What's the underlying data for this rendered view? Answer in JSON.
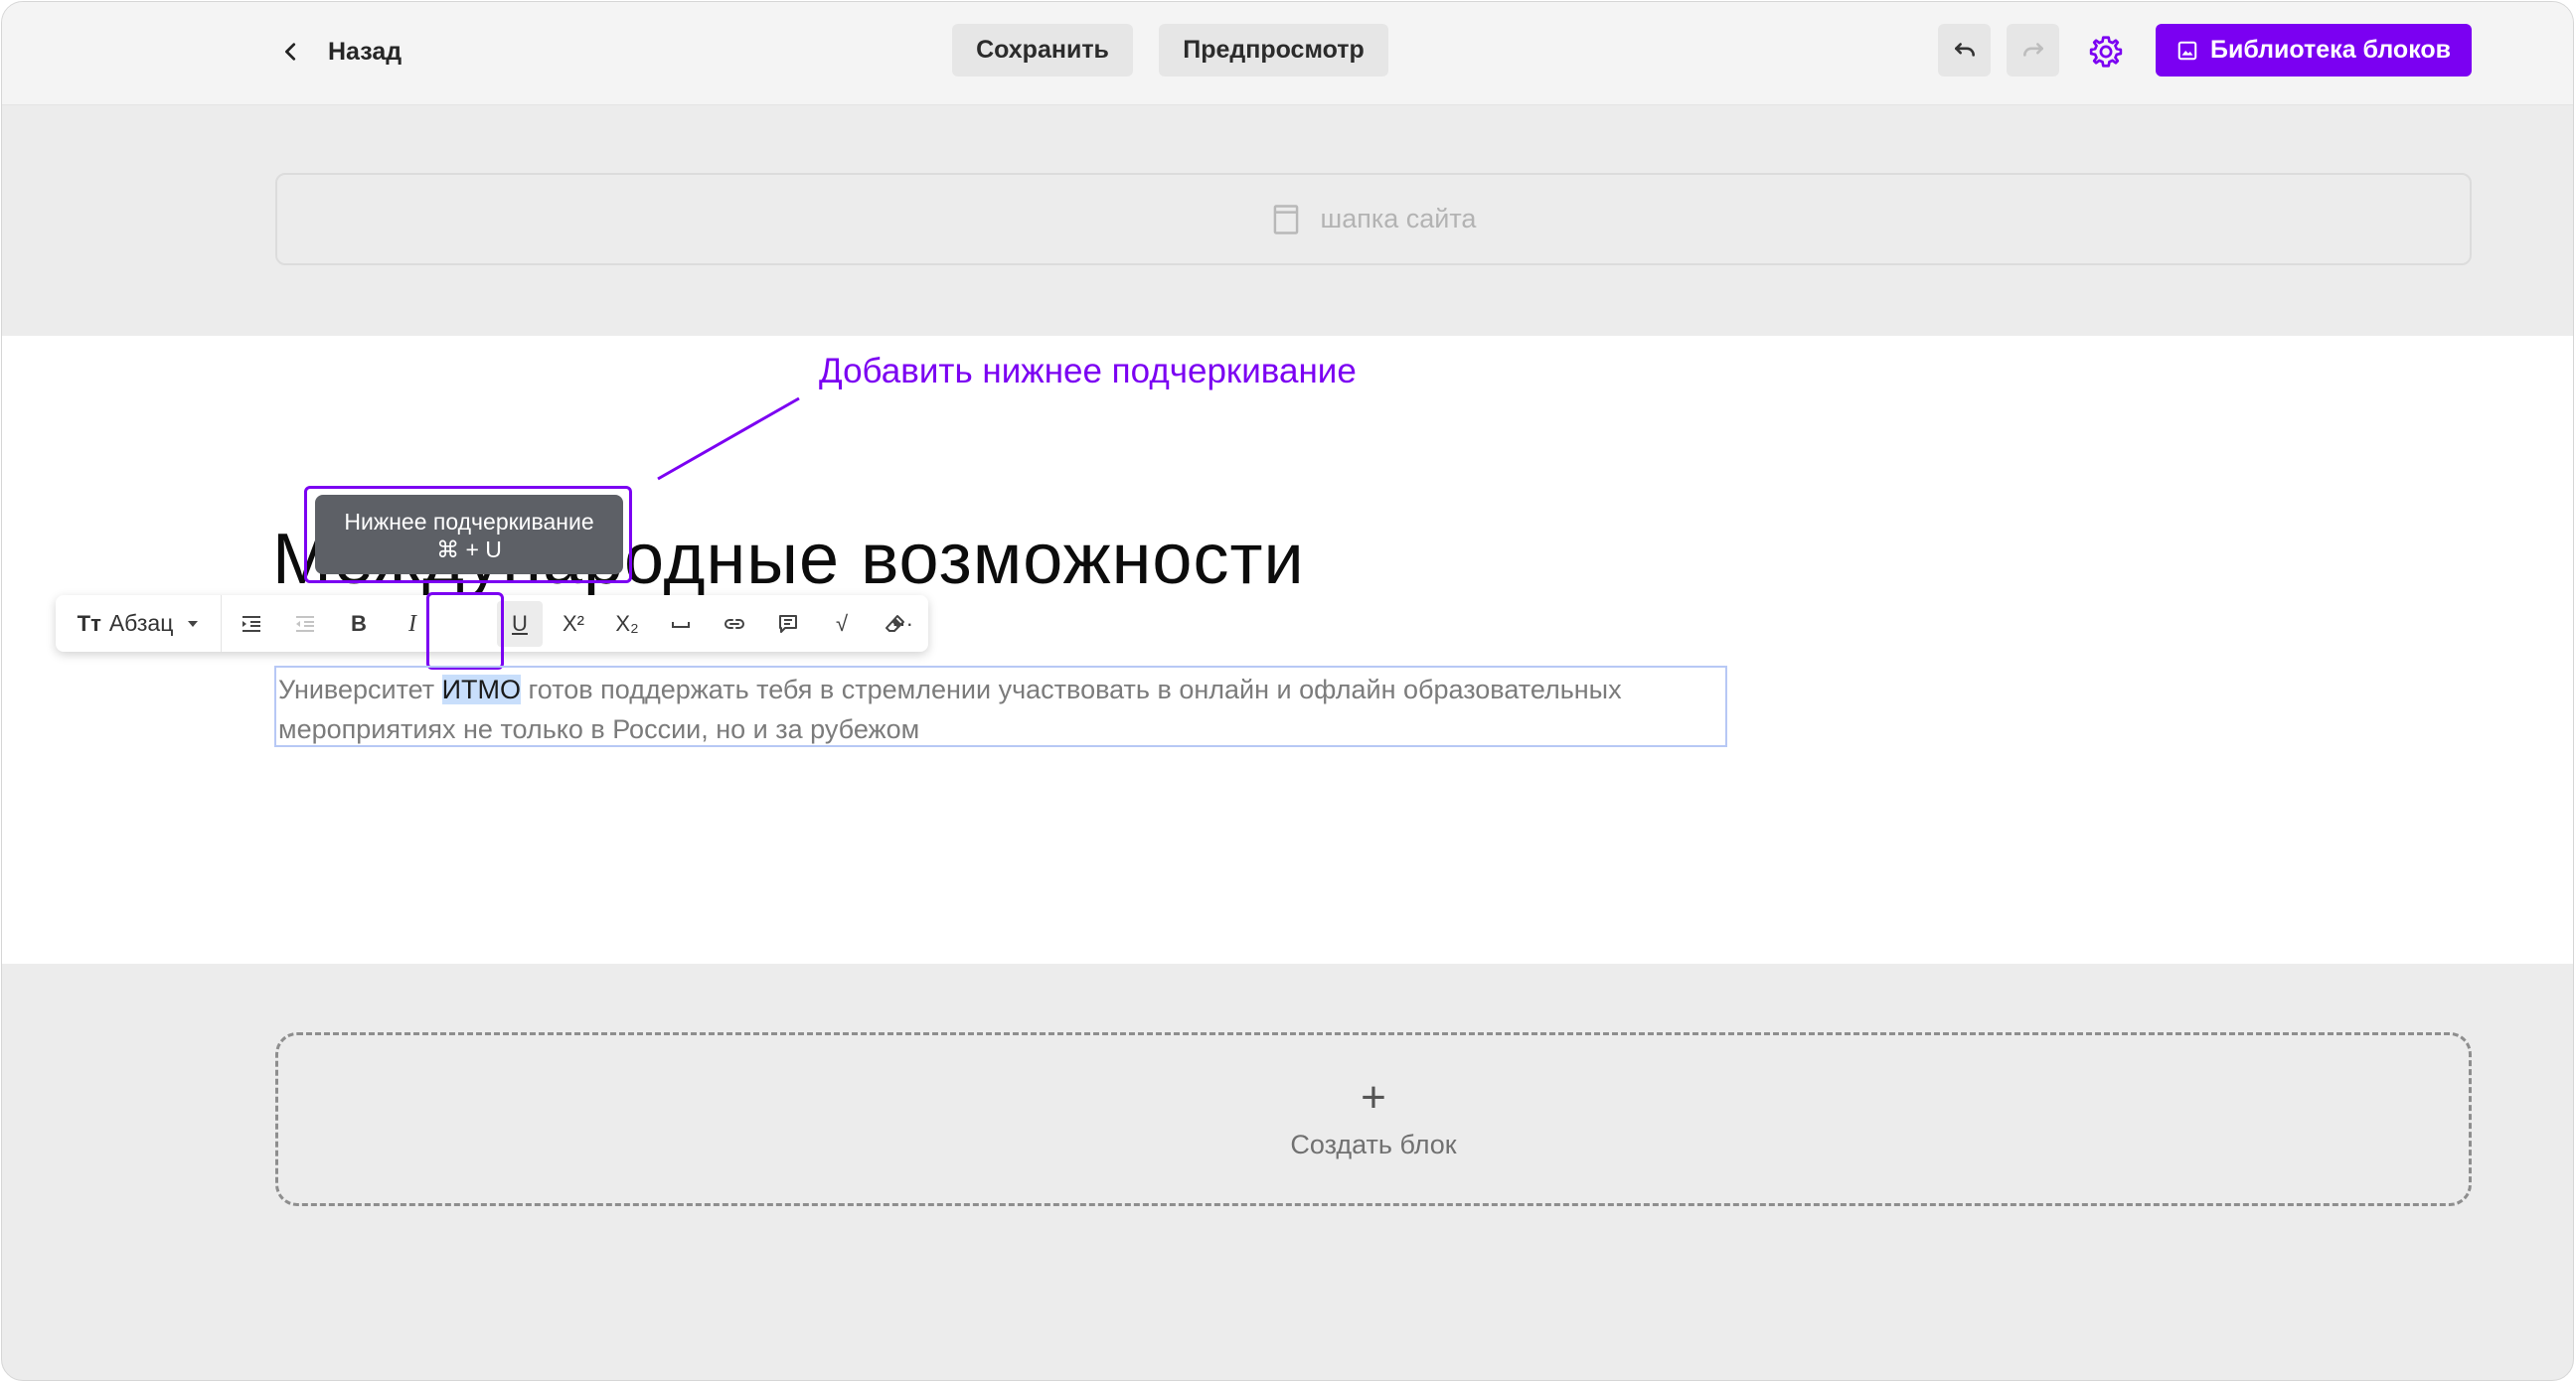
{
  "topbar": {
    "back_label": "Назад",
    "save_label": "Сохранить",
    "preview_label": "Предпросмотр",
    "library_label": "Библиотека блоков"
  },
  "header_slot": {
    "label": "шапка сайта"
  },
  "annotation": {
    "text": "Добавить нижнее подчеркивание"
  },
  "tooltip": {
    "title": "Нижнее подчеркивание",
    "shortcut": "⌘ + U"
  },
  "heading": {
    "text": "Международные возможности"
  },
  "toolbar": {
    "style_label": "Абзац",
    "style_icon_text": "Тт",
    "buttons": [
      {
        "name": "indent-icon"
      },
      {
        "name": "outdent-icon"
      },
      {
        "name": "bold-icon",
        "glyph": "B"
      },
      {
        "name": "italic-icon",
        "glyph": "I"
      },
      {
        "name": "underline-icon",
        "glyph": "U"
      },
      {
        "name": "superscript-icon",
        "glyph": "X²"
      },
      {
        "name": "subscript-icon",
        "glyph": "X₂"
      },
      {
        "name": "space-icon"
      },
      {
        "name": "link-icon"
      },
      {
        "name": "comment-icon"
      },
      {
        "name": "formula-icon",
        "glyph": "√"
      },
      {
        "name": "eraser-icon"
      },
      {
        "name": "more-icon",
        "glyph": "···"
      }
    ]
  },
  "paragraph": {
    "before": "Университет ",
    "selected": "ИТМО",
    "after": " готов поддержать тебя в стремлении участвовать в онлайн и офлайн образовательных мероприятиях не только в России, но и за рубежом"
  },
  "create_block": {
    "plus": "+",
    "label": "Создать блок"
  },
  "colors": {
    "accent": "#7b00f2",
    "selection": "#c8defb",
    "tooltip": "#5d6066"
  }
}
